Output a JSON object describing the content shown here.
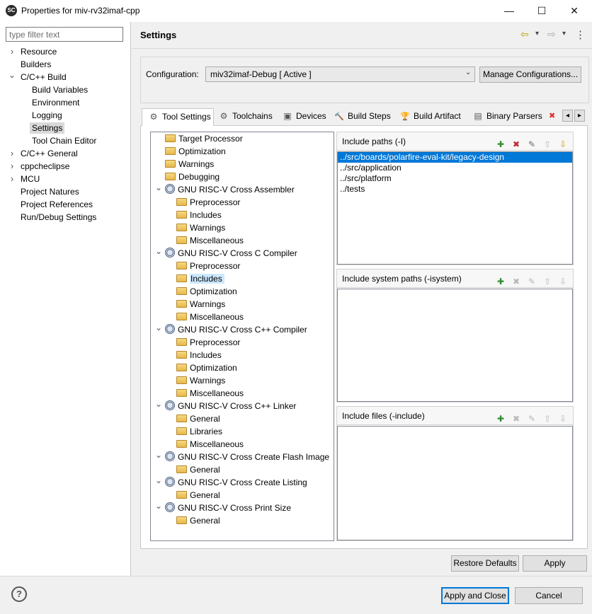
{
  "window": {
    "app_icon_text": "SC",
    "title": "Properties for miv-rv32imaf-cpp",
    "minimize_glyph": "—",
    "maximize_glyph": "☐",
    "close_glyph": "✕"
  },
  "sidebar": {
    "filter_placeholder": "type filter text",
    "items": [
      {
        "label": "Resource",
        "expanded": false,
        "has_children": true,
        "level": 0
      },
      {
        "label": "Builders",
        "has_children": false,
        "level": 0
      },
      {
        "label": "C/C++ Build",
        "expanded": true,
        "has_children": true,
        "level": 0
      },
      {
        "label": "Build Variables",
        "level": 1
      },
      {
        "label": "Environment",
        "level": 1
      },
      {
        "label": "Logging",
        "level": 1
      },
      {
        "label": "Settings",
        "level": 1,
        "selected": true
      },
      {
        "label": "Tool Chain Editor",
        "level": 1
      },
      {
        "label": "C/C++ General",
        "expanded": false,
        "has_children": true,
        "level": 0
      },
      {
        "label": "cppcheclipse",
        "expanded": false,
        "has_children": true,
        "level": 0
      },
      {
        "label": "MCU",
        "expanded": false,
        "has_children": true,
        "level": 0
      },
      {
        "label": "Project Natures",
        "level": 0
      },
      {
        "label": "Project References",
        "level": 0
      },
      {
        "label": "Run/Debug Settings",
        "level": 0
      }
    ]
  },
  "header": {
    "title": "Settings",
    "back_glyph": "⇦",
    "forward_glyph": "⇨",
    "dropdown_glyph": "▾",
    "menu_glyph": "⋮"
  },
  "configuration": {
    "label": "Configuration:",
    "value": "miv32imaf-Debug  [ Active ]",
    "manage_button": "Manage Configurations..."
  },
  "tabs": [
    {
      "label": "Tool Settings",
      "icon": "gear-icon",
      "glyph": "⚙",
      "active": true
    },
    {
      "label": "Toolchains",
      "icon": "gear-icon",
      "glyph": "⚙"
    },
    {
      "label": "Devices",
      "icon": "chip-icon",
      "glyph": "▣"
    },
    {
      "label": "Build Steps",
      "icon": "hammer-icon",
      "glyph": "🔨"
    },
    {
      "label": "Build Artifact",
      "icon": "trophy-icon",
      "glyph": "🏆"
    },
    {
      "label": "Binary Parsers",
      "icon": "binary-icon",
      "glyph": "▤"
    }
  ],
  "tab_scroll": {
    "error_glyph": "✖",
    "left_glyph": "◂",
    "right_glyph": "▸"
  },
  "tool_tree": [
    {
      "label": "Target Processor",
      "icon": "folder",
      "level": 0
    },
    {
      "label": "Optimization",
      "icon": "folder",
      "level": 0
    },
    {
      "label": "Warnings",
      "icon": "folder",
      "level": 0
    },
    {
      "label": "Debugging",
      "icon": "folder",
      "level": 0
    },
    {
      "label": "GNU RISC-V Cross Assembler",
      "icon": "gear",
      "level": 0,
      "expanded": true
    },
    {
      "label": "Preprocessor",
      "icon": "folder",
      "level": 1
    },
    {
      "label": "Includes",
      "icon": "folder",
      "level": 1
    },
    {
      "label": "Warnings",
      "icon": "folder",
      "level": 1
    },
    {
      "label": "Miscellaneous",
      "icon": "folder",
      "level": 1
    },
    {
      "label": "GNU RISC-V Cross C Compiler",
      "icon": "gear",
      "level": 0,
      "expanded": true
    },
    {
      "label": "Preprocessor",
      "icon": "folder",
      "level": 1
    },
    {
      "label": "Includes",
      "icon": "folder",
      "level": 1,
      "selected": true
    },
    {
      "label": "Optimization",
      "icon": "folder",
      "level": 1
    },
    {
      "label": "Warnings",
      "icon": "folder",
      "level": 1
    },
    {
      "label": "Miscellaneous",
      "icon": "folder",
      "level": 1
    },
    {
      "label": "GNU RISC-V Cross C++ Compiler",
      "icon": "gear",
      "level": 0,
      "expanded": true
    },
    {
      "label": "Preprocessor",
      "icon": "folder",
      "level": 1
    },
    {
      "label": "Includes",
      "icon": "folder",
      "level": 1
    },
    {
      "label": "Optimization",
      "icon": "folder",
      "level": 1
    },
    {
      "label": "Warnings",
      "icon": "folder",
      "level": 1
    },
    {
      "label": "Miscellaneous",
      "icon": "folder",
      "level": 1
    },
    {
      "label": "GNU RISC-V Cross C++ Linker",
      "icon": "gear",
      "level": 0,
      "expanded": true
    },
    {
      "label": "General",
      "icon": "folder",
      "level": 1
    },
    {
      "label": "Libraries",
      "icon": "folder",
      "level": 1
    },
    {
      "label": "Miscellaneous",
      "icon": "folder",
      "level": 1
    },
    {
      "label": "GNU RISC-V Cross Create Flash Image",
      "icon": "gear",
      "level": 0,
      "expanded": true
    },
    {
      "label": "General",
      "icon": "folder",
      "level": 1
    },
    {
      "label": "GNU RISC-V Cross Create Listing",
      "icon": "gear",
      "level": 0,
      "expanded": true
    },
    {
      "label": "General",
      "icon": "folder",
      "level": 1
    },
    {
      "label": "GNU RISC-V Cross Print Size",
      "icon": "gear",
      "level": 0,
      "expanded": true
    },
    {
      "label": "General",
      "icon": "folder",
      "level": 1
    }
  ],
  "include_panels": [
    {
      "title": "Include paths (-I)",
      "tools_enabled": [
        true,
        true,
        true,
        false,
        true
      ],
      "items": [
        "../src/boards/polarfire-eval-kit/legacy-design",
        "../src/application",
        "../src/platform",
        "../tests"
      ],
      "selected_index": 0
    },
    {
      "title": "Include system paths (-isystem)",
      "tools_enabled": [
        true,
        false,
        false,
        false,
        false
      ],
      "items": []
    },
    {
      "title": "Include files (-include)",
      "tools_enabled": [
        true,
        false,
        false,
        false,
        false
      ],
      "items": []
    }
  ],
  "include_tool_glyphs": [
    "✚",
    "✖",
    "✎",
    "⇧",
    "⇩"
  ],
  "include_tool_names": [
    "add-icon",
    "delete-icon",
    "edit-icon",
    "move-up-icon",
    "move-down-icon"
  ],
  "footer": {
    "restore_defaults": "Restore Defaults",
    "apply": "Apply",
    "help_glyph": "?",
    "apply_and_close": "Apply and Close",
    "cancel": "Cancel"
  },
  "colors": {
    "selection": "#0078d7",
    "tree_selection": "#cce8ff",
    "accent_border": "#0078d7"
  }
}
